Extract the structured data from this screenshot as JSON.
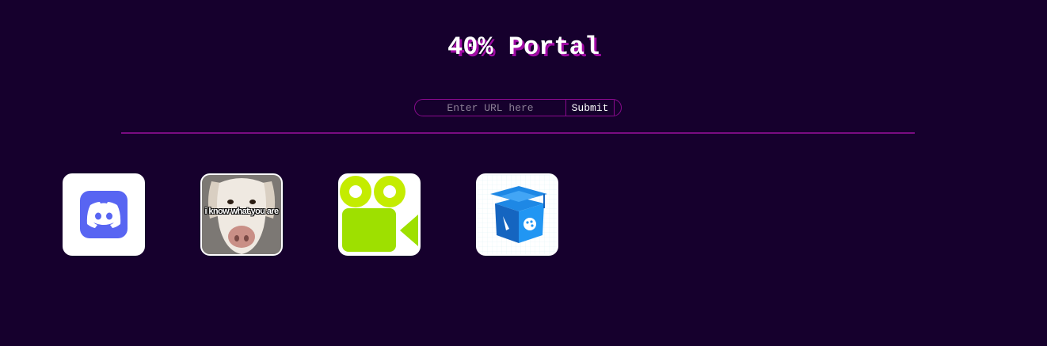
{
  "header": {
    "title": "40% Portal"
  },
  "url_form": {
    "placeholder": "Enter URL here",
    "value": "",
    "submit_label": "Submit"
  },
  "apps": [
    {
      "icon": "discord-icon"
    },
    {
      "icon": "dog-meme-icon",
      "caption": "i know what you are"
    },
    {
      "icon": "video-camera-icon"
    },
    {
      "icon": "graduation-cap-book-icon"
    }
  ],
  "colors": {
    "background": "#16002d",
    "accent": "#a10aa5",
    "border": "#8a0a8e",
    "discord": "#5865f2",
    "camera_green": "#9ee000",
    "edu_blue": "#1e88e5"
  }
}
